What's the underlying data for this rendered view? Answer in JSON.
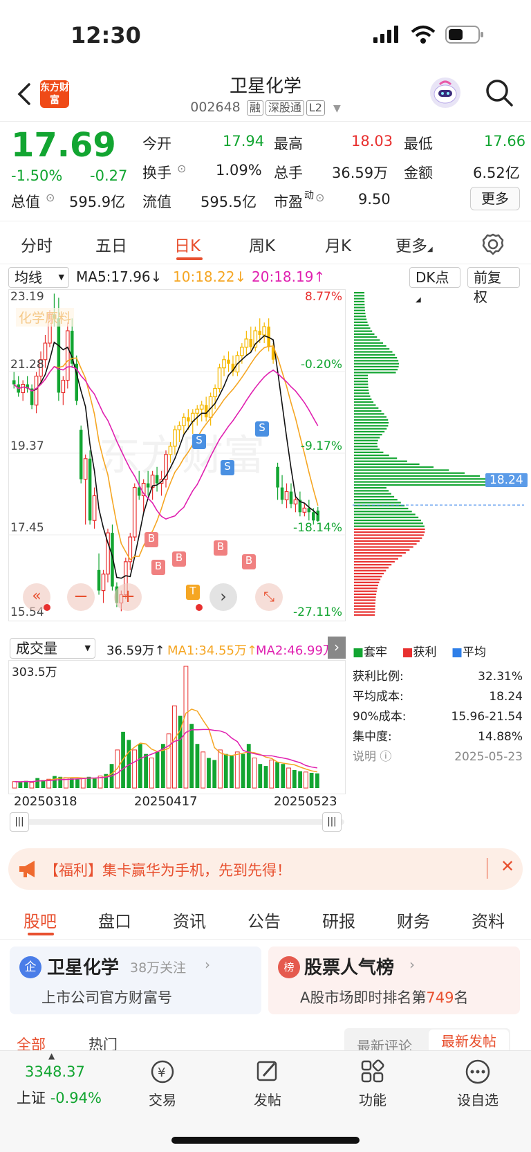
{
  "status_bar": {
    "time": "12:30"
  },
  "header": {
    "logo_text": "东方财富",
    "stock_name": "卫星化学",
    "stock_code": "002648",
    "tags": [
      "融",
      "深股通",
      "L2"
    ]
  },
  "quote": {
    "price": "17.69",
    "change_pct": "-1.50%",
    "change": "-0.27",
    "fields": [
      {
        "label": "今开",
        "value": "17.94",
        "color": "#12a531"
      },
      {
        "label": "最高",
        "value": "18.03",
        "color": "#e8302f"
      },
      {
        "label": "最低",
        "value": "17.66",
        "color": "#12a531"
      },
      {
        "label": "换手",
        "value": "1.09%",
        "color": "#222222"
      },
      {
        "label": "总手",
        "value": "36.59万",
        "color": "#222222"
      },
      {
        "label": "金额",
        "value": "6.52亿",
        "color": "#222222"
      },
      {
        "label": "总值",
        "value": "595.9亿",
        "color": "#222222"
      },
      {
        "label": "流值",
        "value": "595.5亿",
        "color": "#222222"
      },
      {
        "label": "市盈",
        "value": "9.50",
        "color": "#222222"
      }
    ],
    "pe_sup": "动",
    "more_label": "更多"
  },
  "chart_tabs": [
    "分时",
    "五日",
    "日K",
    "周K",
    "月K",
    "更多"
  ],
  "chart_tabs_active": "日K",
  "kline": {
    "indicator_select": "均线",
    "ma5": "MA5:17.96",
    "ma5_arrow": "↓",
    "ma10": "10:18.22",
    "ma10_arrow": "↓",
    "ma20": "20:18.19",
    "ma20_arrow": "↑",
    "dk_label": "DK点",
    "adjust_label": "前复权",
    "sector_label": "化学原料",
    "y_labels": [
      "23.19",
      "21.28",
      "19.37",
      "17.45",
      "15.54"
    ],
    "pct_labels": [
      {
        "text": "8.77%",
        "color": "#e8302f"
      },
      {
        "text": "-0.20%",
        "color": "#12a531"
      },
      {
        "text": "-9.17%",
        "color": "#12a531"
      },
      {
        "text": "-18.14%",
        "color": "#12a531"
      },
      {
        "text": "-27.11%",
        "color": "#12a531"
      }
    ],
    "signal_b": "B",
    "signal_s": "S",
    "signal_t": "T"
  },
  "volume": {
    "select": "成交量",
    "value": "36.59万",
    "value_arrow": "↑",
    "ma1": "MA1:34.55万",
    "ma1_arrow": "↑",
    "ma2": "MA2:46.99万",
    "max_label": "303.5万",
    "dates": [
      "20250318",
      "20250417",
      "20250523"
    ]
  },
  "chips": {
    "avg_cost_marker": "18.24",
    "legend": [
      {
        "label": "套牢",
        "color": "#12a531"
      },
      {
        "label": "获利",
        "color": "#e8302f"
      },
      {
        "label": "平均",
        "color": "#2f7fe8"
      }
    ],
    "stats": [
      {
        "label": "获利比例:",
        "value": "32.31%"
      },
      {
        "label": "平均成本:",
        "value": "18.24"
      },
      {
        "label": "90%成本:",
        "value": "15.96-21.54"
      },
      {
        "label": "集中度:",
        "value": "14.88%"
      }
    ],
    "note_label": "说明",
    "date": "2025-05-23"
  },
  "banner": {
    "text": "【福利】集卡赢华为手机，先到先得！"
  },
  "content_tabs": [
    "股吧",
    "盘口",
    "资讯",
    "公告",
    "研报",
    "财务",
    "资料"
  ],
  "content_tabs_active": "股吧",
  "cards": [
    {
      "icon": "企",
      "title": "卫星化学",
      "meta": "38万关注",
      "sub": "上市公司官方财富号"
    },
    {
      "icon": "榜",
      "title": "股票人气榜",
      "meta": "",
      "sub_pre": "A股市场即时排名第",
      "rank": "749",
      "sub_post": "名"
    }
  ],
  "sub_tabs": [
    "全部",
    "热门"
  ],
  "sort_tabs": [
    "最新评论",
    "最新发帖"
  ],
  "bottom_nav": {
    "index_value": "3348.37",
    "index_name": "上证",
    "index_change": "-0.94%",
    "items": [
      "交易",
      "发帖",
      "功能",
      "设自选"
    ]
  },
  "chart_data": {
    "type": "candlestick",
    "title": "卫星化学 日K",
    "y_axis_labels": [
      23.19,
      21.28,
      19.37,
      17.45,
      15.54
    ],
    "x_labels": [
      "20250318",
      "20250417",
      "20250523"
    ],
    "ohlc": [
      [
        21.1,
        21.3,
        20.9,
        21.0
      ],
      [
        21.0,
        21.2,
        20.7,
        20.8
      ],
      [
        20.8,
        21.1,
        20.6,
        21.0
      ],
      [
        21.0,
        21.2,
        20.8,
        20.9
      ],
      [
        20.9,
        21.0,
        20.4,
        20.5
      ],
      [
        20.5,
        21.3,
        20.3,
        21.2
      ],
      [
        21.2,
        21.8,
        21.0,
        21.6
      ],
      [
        21.6,
        22.2,
        21.4,
        22.0
      ],
      [
        22.0,
        22.8,
        21.9,
        22.7
      ],
      [
        22.7,
        23.2,
        22.4,
        22.6
      ],
      [
        22.6,
        23.1,
        20.6,
        20.8
      ],
      [
        20.8,
        21.2,
        20.5,
        21.1
      ],
      [
        21.1,
        22.5,
        20.9,
        22.3
      ],
      [
        22.3,
        22.6,
        21.4,
        21.5
      ],
      [
        21.5,
        21.7,
        20.5,
        20.6
      ],
      [
        19.9,
        20.0,
        18.6,
        18.7
      ],
      [
        18.7,
        19.3,
        17.6,
        19.2
      ],
      [
        19.2,
        19.4,
        17.6,
        17.7
      ],
      [
        17.7,
        18.5,
        17.5,
        18.3
      ],
      [
        16.5,
        16.9,
        15.9,
        16.0
      ],
      [
        16.0,
        16.5,
        15.7,
        16.4
      ],
      [
        16.4,
        17.5,
        16.2,
        17.4
      ],
      [
        17.4,
        17.6,
        16.0,
        16.1
      ],
      [
        16.1,
        16.2,
        15.6,
        15.7
      ],
      [
        15.7,
        16.0,
        15.5,
        15.9
      ],
      [
        15.9,
        16.8,
        15.8,
        16.7
      ],
      [
        16.7,
        17.4,
        16.5,
        17.3
      ],
      [
        17.3,
        18.6,
        17.2,
        18.5
      ],
      [
        18.5,
        18.9,
        18.2,
        18.3
      ],
      [
        18.3,
        18.7,
        17.9,
        18.6
      ],
      [
        18.6,
        18.9,
        18.3,
        18.5
      ],
      [
        18.5,
        18.9,
        18.2,
        18.8
      ],
      [
        18.8,
        19.0,
        18.4,
        18.6
      ],
      [
        18.6,
        18.9,
        18.3,
        18.7
      ],
      [
        18.7,
        19.4,
        18.5,
        19.3
      ],
      [
        19.3,
        19.6,
        19.1,
        19.5
      ],
      [
        19.5,
        20.0,
        19.3,
        19.9
      ],
      [
        19.9,
        20.1,
        19.6,
        20.0
      ],
      [
        20.0,
        20.3,
        19.8,
        20.2
      ],
      [
        20.2,
        20.4,
        19.9,
        20.1
      ],
      [
        20.1,
        20.4,
        19.8,
        20.3
      ],
      [
        20.3,
        20.5,
        20.0,
        20.4
      ],
      [
        20.4,
        20.6,
        20.1,
        20.5
      ],
      [
        20.5,
        20.7,
        20.1,
        20.2
      ],
      [
        20.2,
        20.8,
        20.0,
        20.7
      ],
      [
        20.7,
        21.0,
        20.4,
        20.9
      ],
      [
        20.9,
        21.5,
        20.8,
        21.4
      ],
      [
        21.4,
        21.7,
        21.2,
        21.6
      ],
      [
        21.6,
        21.8,
        21.3,
        21.5
      ],
      [
        21.5,
        21.7,
        21.2,
        21.3
      ],
      [
        21.3,
        21.8,
        21.2,
        21.7
      ],
      [
        21.7,
        22.0,
        21.5,
        21.9
      ],
      [
        21.9,
        22.3,
        21.7,
        22.1
      ],
      [
        22.1,
        22.4,
        21.8,
        21.9
      ],
      [
        21.9,
        22.4,
        21.8,
        22.3
      ],
      [
        22.3,
        22.6,
        22.0,
        22.2
      ],
      [
        22.2,
        22.5,
        22.0,
        22.4
      ],
      [
        22.4,
        22.6,
        21.8,
        21.9
      ],
      [
        21.9,
        22.0,
        21.5,
        21.6
      ],
      [
        19.0,
        19.1,
        18.2,
        18.5
      ],
      [
        18.5,
        18.8,
        18.1,
        18.2
      ],
      [
        18.2,
        18.6,
        18.0,
        18.4
      ],
      [
        18.4,
        18.6,
        18.0,
        18.1
      ],
      [
        18.1,
        18.3,
        17.9,
        18.2
      ],
      [
        18.2,
        18.4,
        17.8,
        17.9
      ],
      [
        17.9,
        18.1,
        17.8,
        18.0
      ],
      [
        18.0,
        18.2,
        17.7,
        17.9
      ],
      [
        17.9,
        18.0,
        17.6,
        17.7
      ],
      [
        17.94,
        18.03,
        17.66,
        17.69
      ]
    ],
    "volume": [
      16,
      15,
      18,
      14,
      25,
      20,
      22,
      30,
      28,
      26,
      24,
      22,
      25,
      28,
      24,
      30,
      35,
      60,
      95,
      140,
      120,
      95,
      110,
      85,
      75,
      90,
      110,
      135,
      205,
      180,
      303.5,
      160,
      110,
      90,
      75,
      70,
      95,
      85,
      80,
      90,
      85,
      110,
      75,
      60,
      55,
      70,
      65,
      60,
      50,
      45,
      42,
      40,
      38,
      36.59
    ],
    "volume_unit": "万"
  }
}
